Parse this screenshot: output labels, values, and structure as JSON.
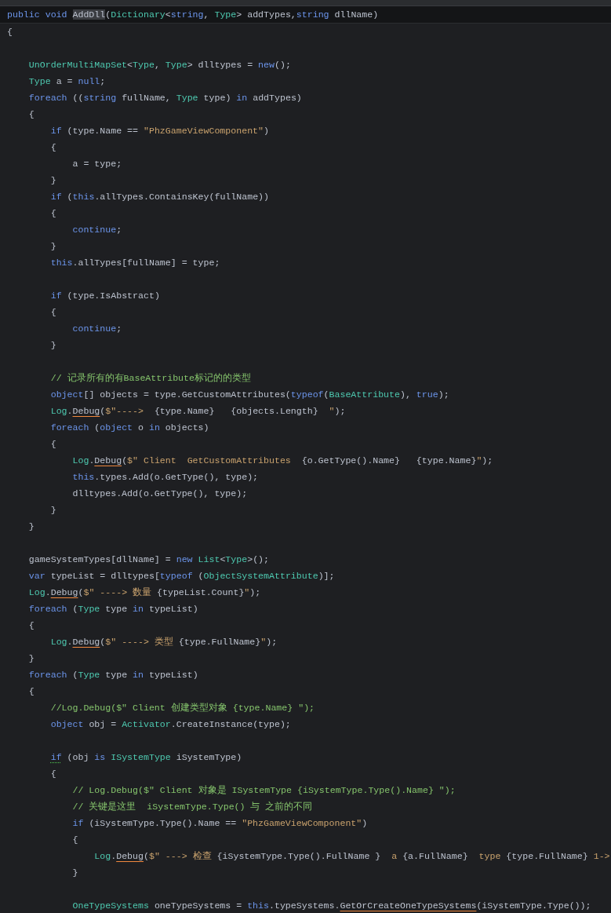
{
  "editor": {
    "lines": [
      {
        "kind": "code",
        "sticky": true,
        "tokens": [
          {
            "text": "public void ",
            "kind": "keyword"
          },
          {
            "text": "AddDll",
            "kind": "highlight"
          },
          {
            "text": "(",
            "kind": "plain"
          },
          {
            "text": "Dictionary",
            "kind": "type"
          },
          {
            "text": "<",
            "kind": "plain"
          },
          {
            "text": "string",
            "kind": "keyword"
          },
          {
            "text": ", ",
            "kind": "plain"
          },
          {
            "text": "Type",
            "kind": "type"
          },
          {
            "text": "> addTypes,",
            "kind": "plain"
          },
          {
            "text": "string",
            "kind": "keyword"
          },
          {
            "text": " dllName)",
            "kind": "plain"
          }
        ]
      },
      {
        "kind": "code",
        "tokens": [
          {
            "text": "{",
            "kind": "plain"
          }
        ]
      },
      {
        "kind": "blank"
      },
      {
        "kind": "code",
        "tokens": [
          {
            "text": "    UnOrderMultiMapSet",
            "kind": "type"
          },
          {
            "text": "<",
            "kind": "plain"
          },
          {
            "text": "Type",
            "kind": "type"
          },
          {
            "text": ", ",
            "kind": "plain"
          },
          {
            "text": "Type",
            "kind": "type"
          },
          {
            "text": "> dlltypes = ",
            "kind": "plain"
          },
          {
            "text": "new",
            "kind": "keyword"
          },
          {
            "text": "();",
            "kind": "plain"
          }
        ]
      },
      {
        "kind": "code",
        "tokens": [
          {
            "text": "    Type",
            "kind": "type"
          },
          {
            "text": " a = ",
            "kind": "plain"
          },
          {
            "text": "null",
            "kind": "keyword"
          },
          {
            "text": ";",
            "kind": "plain"
          }
        ]
      },
      {
        "kind": "code",
        "tokens": [
          {
            "text": "    foreach",
            "kind": "keyword"
          },
          {
            "text": " ((",
            "kind": "plain"
          },
          {
            "text": "string",
            "kind": "keyword"
          },
          {
            "text": " fullName, ",
            "kind": "plain"
          },
          {
            "text": "Type",
            "kind": "type"
          },
          {
            "text": " type) ",
            "kind": "plain"
          },
          {
            "text": "in",
            "kind": "keyword"
          },
          {
            "text": " addTypes)",
            "kind": "plain"
          }
        ]
      },
      {
        "kind": "code",
        "tokens": [
          {
            "text": "    {",
            "kind": "plain"
          }
        ]
      },
      {
        "kind": "code",
        "tokens": [
          {
            "text": "        if",
            "kind": "keyword"
          },
          {
            "text": " (type.Name == ",
            "kind": "plain"
          },
          {
            "text": "\"PhzGameViewComponent\"",
            "kind": "string"
          },
          {
            "text": ")",
            "kind": "plain"
          }
        ]
      },
      {
        "kind": "code",
        "tokens": [
          {
            "text": "        {",
            "kind": "plain"
          }
        ]
      },
      {
        "kind": "code",
        "tokens": [
          {
            "text": "            a = type;",
            "kind": "plain"
          }
        ]
      },
      {
        "kind": "code",
        "tokens": [
          {
            "text": "        }",
            "kind": "plain"
          }
        ]
      },
      {
        "kind": "code",
        "tokens": [
          {
            "text": "        if",
            "kind": "keyword"
          },
          {
            "text": " (",
            "kind": "plain"
          },
          {
            "text": "this",
            "kind": "keyword"
          },
          {
            "text": ".allTypes.ContainsKey(fullName))",
            "kind": "plain"
          }
        ]
      },
      {
        "kind": "code",
        "tokens": [
          {
            "text": "        {",
            "kind": "plain"
          }
        ]
      },
      {
        "kind": "code",
        "tokens": [
          {
            "text": "            continue",
            "kind": "keyword"
          },
          {
            "text": ";",
            "kind": "plain"
          }
        ]
      },
      {
        "kind": "code",
        "tokens": [
          {
            "text": "        }",
            "kind": "plain"
          }
        ]
      },
      {
        "kind": "code",
        "tokens": [
          {
            "text": "        this",
            "kind": "keyword"
          },
          {
            "text": ".allTypes[fullName] = type;",
            "kind": "plain"
          }
        ]
      },
      {
        "kind": "blank"
      },
      {
        "kind": "code",
        "tokens": [
          {
            "text": "        if",
            "kind": "keyword"
          },
          {
            "text": " (type.IsAbstract)",
            "kind": "plain"
          }
        ]
      },
      {
        "kind": "code",
        "tokens": [
          {
            "text": "        {",
            "kind": "plain"
          }
        ]
      },
      {
        "kind": "code",
        "tokens": [
          {
            "text": "            continue",
            "kind": "keyword"
          },
          {
            "text": ";",
            "kind": "plain"
          }
        ]
      },
      {
        "kind": "code",
        "tokens": [
          {
            "text": "        }",
            "kind": "plain"
          }
        ]
      },
      {
        "kind": "blank"
      },
      {
        "kind": "code",
        "tokens": [
          {
            "text": "        // 记录所有的有BaseAttribute标记的的类型",
            "kind": "comment"
          }
        ]
      },
      {
        "kind": "code",
        "tokens": [
          {
            "text": "        object",
            "kind": "keyword"
          },
          {
            "text": "[] objects = type.GetCustomAttributes(",
            "kind": "plain"
          },
          {
            "text": "typeof",
            "kind": "keyword"
          },
          {
            "text": "(",
            "kind": "plain"
          },
          {
            "text": "BaseAttribute",
            "kind": "type"
          },
          {
            "text": "), ",
            "kind": "plain"
          },
          {
            "text": "true",
            "kind": "keyword"
          },
          {
            "text": ");",
            "kind": "plain"
          }
        ]
      },
      {
        "kind": "code",
        "tokens": [
          {
            "text": "        Log",
            "kind": "type"
          },
          {
            "text": ".",
            "kind": "plain"
          },
          {
            "text": "Debug",
            "kind": "warning"
          },
          {
            "text": "(",
            "kind": "plain"
          },
          {
            "text": "$\"---->  ",
            "kind": "string"
          },
          {
            "text": "{type.Name}   ",
            "kind": "plain"
          },
          {
            "text": "{objects.Length}",
            "kind": "plain"
          },
          {
            "text": "  \"",
            "kind": "string"
          },
          {
            "text": ");",
            "kind": "plain"
          }
        ]
      },
      {
        "kind": "code",
        "tokens": [
          {
            "text": "        foreach",
            "kind": "keyword"
          },
          {
            "text": " (",
            "kind": "plain"
          },
          {
            "text": "object",
            "kind": "keyword"
          },
          {
            "text": " o ",
            "kind": "plain"
          },
          {
            "text": "in",
            "kind": "keyword"
          },
          {
            "text": " objects)",
            "kind": "plain"
          }
        ]
      },
      {
        "kind": "code",
        "tokens": [
          {
            "text": "        {",
            "kind": "plain"
          }
        ]
      },
      {
        "kind": "code",
        "tokens": [
          {
            "text": "            Log",
            "kind": "type"
          },
          {
            "text": ".",
            "kind": "plain"
          },
          {
            "text": "Debug",
            "kind": "warning"
          },
          {
            "text": "(",
            "kind": "plain"
          },
          {
            "text": "$\" Client  GetCustomAttributes  ",
            "kind": "string"
          },
          {
            "text": "{o.GetType().Name}   ",
            "kind": "plain"
          },
          {
            "text": "{type.Name}",
            "kind": "plain"
          },
          {
            "text": "\"",
            "kind": "string"
          },
          {
            "text": ");",
            "kind": "plain"
          }
        ]
      },
      {
        "kind": "code",
        "tokens": [
          {
            "text": "            this",
            "kind": "keyword"
          },
          {
            "text": ".types.Add(o.GetType(), type);",
            "kind": "plain"
          }
        ]
      },
      {
        "kind": "code",
        "tokens": [
          {
            "text": "            dlltypes.Add(o.GetType(), type);",
            "kind": "plain"
          }
        ]
      },
      {
        "kind": "code",
        "tokens": [
          {
            "text": "        }",
            "kind": "plain"
          }
        ]
      },
      {
        "kind": "code",
        "tokens": [
          {
            "text": "    }",
            "kind": "plain"
          }
        ]
      },
      {
        "kind": "blank"
      },
      {
        "kind": "code",
        "tokens": [
          {
            "text": "    gameSystemTypes[dllName] = ",
            "kind": "plain"
          },
          {
            "text": "new",
            "kind": "keyword"
          },
          {
            "text": " List",
            "kind": "type"
          },
          {
            "text": "<",
            "kind": "plain"
          },
          {
            "text": "Type",
            "kind": "type"
          },
          {
            "text": ">();",
            "kind": "plain"
          }
        ]
      },
      {
        "kind": "code",
        "tokens": [
          {
            "text": "    var",
            "kind": "keyword"
          },
          {
            "text": " typeList = dlltypes[",
            "kind": "plain"
          },
          {
            "text": "typeof",
            "kind": "keyword"
          },
          {
            "text": " (",
            "kind": "plain"
          },
          {
            "text": "ObjectSystemAttribute",
            "kind": "type"
          },
          {
            "text": ")];",
            "kind": "plain"
          }
        ]
      },
      {
        "kind": "code",
        "tokens": [
          {
            "text": "    Log",
            "kind": "type"
          },
          {
            "text": ".",
            "kind": "plain"
          },
          {
            "text": "Debug",
            "kind": "warning"
          },
          {
            "text": "(",
            "kind": "plain"
          },
          {
            "text": "$\" ----> 数量 ",
            "kind": "string"
          },
          {
            "text": "{typeList.Count}",
            "kind": "plain"
          },
          {
            "text": "\"",
            "kind": "string"
          },
          {
            "text": ");",
            "kind": "plain"
          }
        ]
      },
      {
        "kind": "code",
        "tokens": [
          {
            "text": "    foreach",
            "kind": "keyword"
          },
          {
            "text": " (",
            "kind": "plain"
          },
          {
            "text": "Type",
            "kind": "type"
          },
          {
            "text": " type ",
            "kind": "plain"
          },
          {
            "text": "in",
            "kind": "keyword"
          },
          {
            "text": " typeList)",
            "kind": "plain"
          }
        ]
      },
      {
        "kind": "code",
        "tokens": [
          {
            "text": "    {",
            "kind": "plain"
          }
        ]
      },
      {
        "kind": "code",
        "tokens": [
          {
            "text": "        Log",
            "kind": "type"
          },
          {
            "text": ".",
            "kind": "plain"
          },
          {
            "text": "Debug",
            "kind": "warning"
          },
          {
            "text": "(",
            "kind": "plain"
          },
          {
            "text": "$\" ----> 类型 ",
            "kind": "string"
          },
          {
            "text": "{type.FullName}",
            "kind": "plain"
          },
          {
            "text": "\"",
            "kind": "string"
          },
          {
            "text": ");",
            "kind": "plain"
          }
        ]
      },
      {
        "kind": "code",
        "tokens": [
          {
            "text": "    }",
            "kind": "plain"
          }
        ]
      },
      {
        "kind": "code",
        "tokens": [
          {
            "text": "    foreach",
            "kind": "keyword"
          },
          {
            "text": " (",
            "kind": "plain"
          },
          {
            "text": "Type",
            "kind": "type"
          },
          {
            "text": " type ",
            "kind": "plain"
          },
          {
            "text": "in",
            "kind": "keyword"
          },
          {
            "text": " typeList)",
            "kind": "plain"
          }
        ]
      },
      {
        "kind": "code",
        "tokens": [
          {
            "text": "    {",
            "kind": "plain"
          }
        ]
      },
      {
        "kind": "code",
        "tokens": [
          {
            "text": "        //Log.Debug($\" Client 创建类型对象 {type.Name} \");",
            "kind": "comment"
          }
        ]
      },
      {
        "kind": "code",
        "tokens": [
          {
            "text": "        object",
            "kind": "keyword"
          },
          {
            "text": " obj = ",
            "kind": "plain"
          },
          {
            "text": "Activator",
            "kind": "type"
          },
          {
            "text": ".CreateInstance(type);",
            "kind": "plain"
          }
        ]
      },
      {
        "kind": "blank"
      },
      {
        "kind": "code",
        "tokens": [
          {
            "text": "        if",
            "kind": "hint"
          },
          {
            "text": " (obj ",
            "kind": "plain"
          },
          {
            "text": "is",
            "kind": "keyword"
          },
          {
            "text": " ISystemType",
            "kind": "type"
          },
          {
            "text": " iSystemType)",
            "kind": "plain"
          }
        ]
      },
      {
        "kind": "code",
        "tokens": [
          {
            "text": "        {",
            "kind": "plain"
          }
        ]
      },
      {
        "kind": "code",
        "tokens": [
          {
            "text": "            // Log.Debug($\" Client 对象是 ISystemType {iSystemType.Type().Name} \");",
            "kind": "comment"
          }
        ]
      },
      {
        "kind": "code",
        "tokens": [
          {
            "text": "            // 关键是这里  iSystemType.Type() 与 之前的不同",
            "kind": "comment"
          }
        ]
      },
      {
        "kind": "code",
        "tokens": [
          {
            "text": "            if",
            "kind": "keyword"
          },
          {
            "text": " (iSystemType.Type().Name == ",
            "kind": "plain"
          },
          {
            "text": "\"PhzGameViewComponent\"",
            "kind": "string"
          },
          {
            "text": ")",
            "kind": "plain"
          }
        ]
      },
      {
        "kind": "code",
        "tokens": [
          {
            "text": "            {",
            "kind": "plain"
          }
        ]
      },
      {
        "kind": "code",
        "tokens": [
          {
            "text": "                Log",
            "kind": "type"
          },
          {
            "text": ".",
            "kind": "plain"
          },
          {
            "text": "Debug",
            "kind": "warning"
          },
          {
            "text": "(",
            "kind": "plain"
          },
          {
            "text": "$\" ---> 检查 ",
            "kind": "string"
          },
          {
            "text": "{iSystemType.Type().FullName }",
            "kind": "plain"
          },
          {
            "text": "  a ",
            "kind": "string"
          },
          {
            "text": "{a.FullName}",
            "kind": "plain"
          },
          {
            "text": "  type ",
            "kind": "string"
          },
          {
            "text": "{type.FullName}",
            "kind": "plain"
          },
          {
            "text": " 1->",
            "kind": "string"
          }
        ]
      },
      {
        "kind": "code",
        "tokens": [
          {
            "text": "            }",
            "kind": "plain"
          }
        ]
      },
      {
        "kind": "blank"
      },
      {
        "kind": "code",
        "tokens": [
          {
            "text": "            OneTypeSystems",
            "kind": "type"
          },
          {
            "text": " oneTypeSystems = ",
            "kind": "plain"
          },
          {
            "text": "this",
            "kind": "keyword"
          },
          {
            "text": ".typeSystems.",
            "kind": "plain"
          },
          {
            "text": "GetOrCreateOneTypeSystems",
            "kind": "warning"
          },
          {
            "text": "(iSystemType.Type());",
            "kind": "plain"
          }
        ]
      }
    ]
  }
}
